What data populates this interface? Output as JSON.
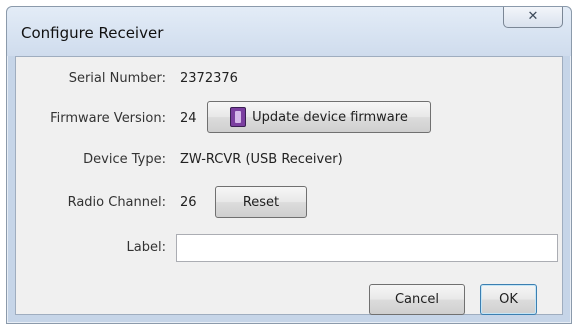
{
  "window": {
    "title": "Configure Receiver",
    "close_glyph": "✕"
  },
  "fields": {
    "serial_label": "Serial Number:",
    "serial_value": "2372376",
    "firmware_label": "Firmware Version:",
    "firmware_value": "24",
    "update_button": "Update device firmware",
    "type_label": "Device Type:",
    "type_value": "ZW-RCVR (USB Receiver)",
    "channel_label": "Radio Channel:",
    "channel_value": "26",
    "reset_button": "Reset",
    "label_label": "Label:",
    "label_value": ""
  },
  "buttons": {
    "cancel": "Cancel",
    "ok": "OK"
  },
  "icons": {
    "update": "firmware-chip-icon",
    "close": "close-icon"
  }
}
